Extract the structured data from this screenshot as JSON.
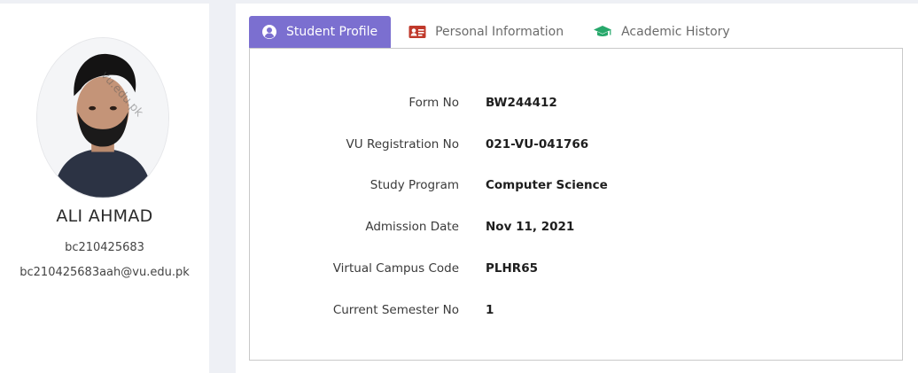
{
  "profile": {
    "name": "ALI AHMAD",
    "student_id": "bc210425683",
    "email": "bc210425683aah@vu.edu.pk"
  },
  "tabs": [
    {
      "label": "Student Profile",
      "icon": "user-circle-icon",
      "active": true
    },
    {
      "label": "Personal Information",
      "icon": "id-card-icon",
      "active": false
    },
    {
      "label": "Academic History",
      "icon": "graduation-cap-icon",
      "active": false
    }
  ],
  "details": {
    "form_no": {
      "label": "Form No",
      "value": "BW244412"
    },
    "vu_registration_no": {
      "label": "VU Registration No",
      "value": "021-VU-041766"
    },
    "study_program": {
      "label": "Study Program",
      "value": "Computer Science"
    },
    "admission_date": {
      "label": "Admission Date",
      "value": "Nov 11, 2021"
    },
    "virtual_campus_code": {
      "label": "Virtual Campus Code",
      "value": "PLHR65"
    },
    "current_semester_no": {
      "label": "Current Semester No",
      "value": "1"
    }
  },
  "colors": {
    "active_tab": "#7b6fd0",
    "id_card_icon": "#c0392b",
    "graduation_cap_icon": "#27a86b"
  }
}
